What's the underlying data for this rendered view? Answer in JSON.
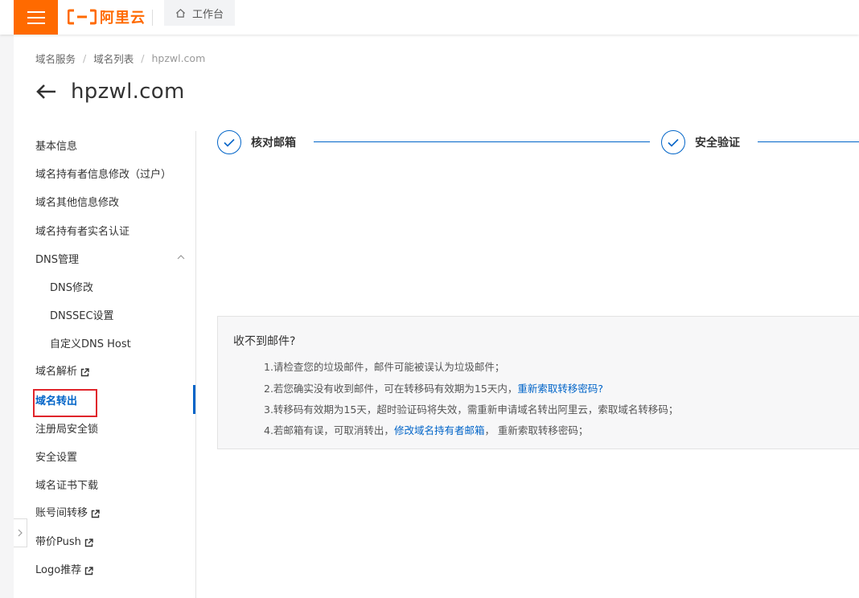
{
  "header": {
    "logo_text": "阿里云",
    "workbench_label": "工作台",
    "brand_color": "#ff6a00"
  },
  "breadcrumb": [
    "域名服务",
    "域名列表",
    "hpzwl.com"
  ],
  "page_title": "hpzwl.com",
  "sidebar": {
    "items": [
      {
        "label": "基本信息"
      },
      {
        "label": "域名持有者信息修改（过户）"
      },
      {
        "label": "域名其他信息修改"
      },
      {
        "label": "域名持有者实名认证"
      },
      {
        "label": "DNS管理"
      },
      {
        "label": "DNS修改"
      },
      {
        "label": "DNSSEC设置"
      },
      {
        "label": "自定义DNS Host"
      },
      {
        "label": "域名解析"
      },
      {
        "label": "域名转出"
      },
      {
        "label": "注册局安全锁"
      },
      {
        "label": "安全设置"
      },
      {
        "label": "域名证书下载"
      },
      {
        "label": "账号间转移"
      },
      {
        "label": "带价Push"
      },
      {
        "label": "Logo推荐"
      }
    ],
    "active": "域名转出"
  },
  "steps": [
    {
      "label": "核对邮箱",
      "status": "done"
    },
    {
      "label": "安全验证",
      "status": "done"
    }
  ],
  "help": {
    "title": "收不到邮件?",
    "line1": "1.请检查您的垃圾邮件，邮件可能被误认为垃圾邮件；",
    "line2_text": "2.若您确实没有收到邮件，可在转移码有效期为15天内，",
    "line2_link": "重新索取转移密码?",
    "line3": "3.转移码有效期为15天，超时验证码将失效，需重新申请域名转出阿里云，索取域名转移码；",
    "line4_text": "4.若邮箱有误，可取消转出，",
    "line4_link": "修改域名持有者邮箱",
    "line4_tail": "， 重新索取转移密码；"
  },
  "colors": {
    "link": "#0064c8",
    "highlight": "#e0252b"
  }
}
